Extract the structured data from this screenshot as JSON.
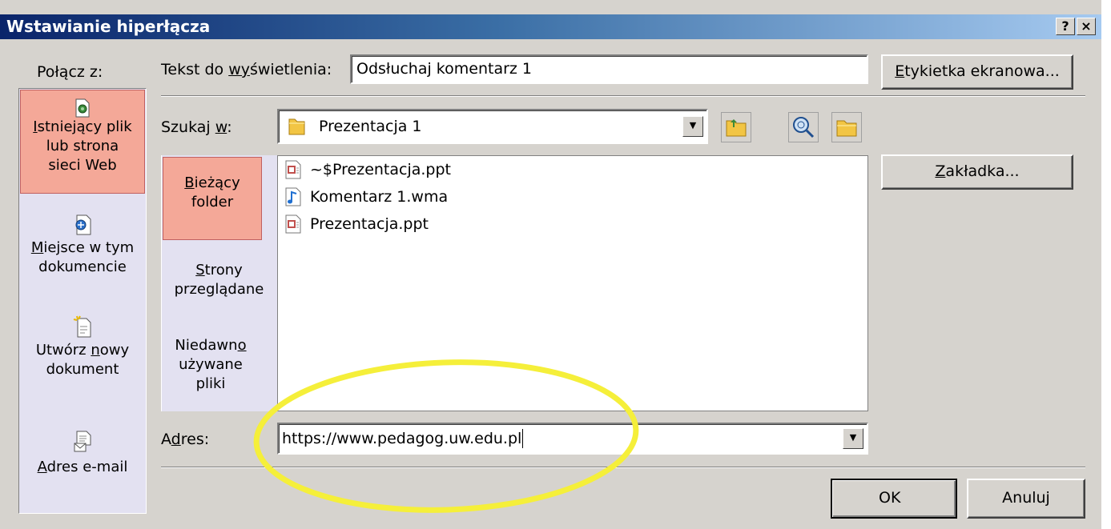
{
  "window": {
    "title": "Wstawianie hiperłącza",
    "help_glyph": "?",
    "close_glyph": "×"
  },
  "connect": {
    "label": "Połącz z:",
    "items": [
      {
        "label_line1_pre": "",
        "label_line1_u": "I",
        "label_line1_post": "stniejący plik",
        "label_line2": "lub strona",
        "label_line3": "sieci Web",
        "icon": "existing-file-icon"
      },
      {
        "label_line1_pre": "",
        "label_line1_u": "M",
        "label_line1_post": "iejsce w tym",
        "label_line2": "dokumencie",
        "icon": "place-in-document-icon"
      },
      {
        "label_line1_pre": "Utwórz ",
        "label_line1_u": "n",
        "label_line1_post": "owy",
        "label_line2": "dokument",
        "icon": "new-document-icon"
      },
      {
        "label_line1_pre": "",
        "label_line1_u": "A",
        "label_line1_post": "dres e-mail",
        "icon": "email-address-icon"
      }
    ]
  },
  "display_text": {
    "label_pre": "Tekst do ",
    "label_u": "wy",
    "label_post": "świetlenia:",
    "value": "Odsłuchaj komentarz 1"
  },
  "screentip_button": {
    "u": "E",
    "rest": "tykietka ekranowa..."
  },
  "look_in": {
    "label_pre": "Szukaj ",
    "label_u": "w",
    "label_post": ":",
    "value": "Prezentacja 1"
  },
  "tabs": [
    {
      "u": "B",
      "rest": "ieżący",
      "line2": "folder"
    },
    {
      "u": "S",
      "rest": "trony",
      "line2": "przeglądane"
    },
    {
      "pre": "Niedawn",
      "u": "o",
      "line2": "używane",
      "line3": "pliki"
    }
  ],
  "files": [
    {
      "name": "~$Prezentacja.ppt",
      "icon": "powerpoint-file-icon"
    },
    {
      "name": "Komentarz 1.wma",
      "icon": "audio-file-icon"
    },
    {
      "name": "Prezentacja.ppt",
      "icon": "powerpoint-file-icon"
    }
  ],
  "bookmark_button": {
    "u": "Z",
    "rest": "akładka..."
  },
  "address": {
    "label_pre": "A",
    "label_u": "d",
    "label_post": "res:",
    "value": "https://www.pedagog.uw.edu.pl"
  },
  "ok_label": "OK",
  "cancel_label": "Anuluj",
  "colors": {
    "highlight_ellipse": "#f5ef3a",
    "active_item": "#f4a898",
    "title_bar": "#0a246a"
  }
}
